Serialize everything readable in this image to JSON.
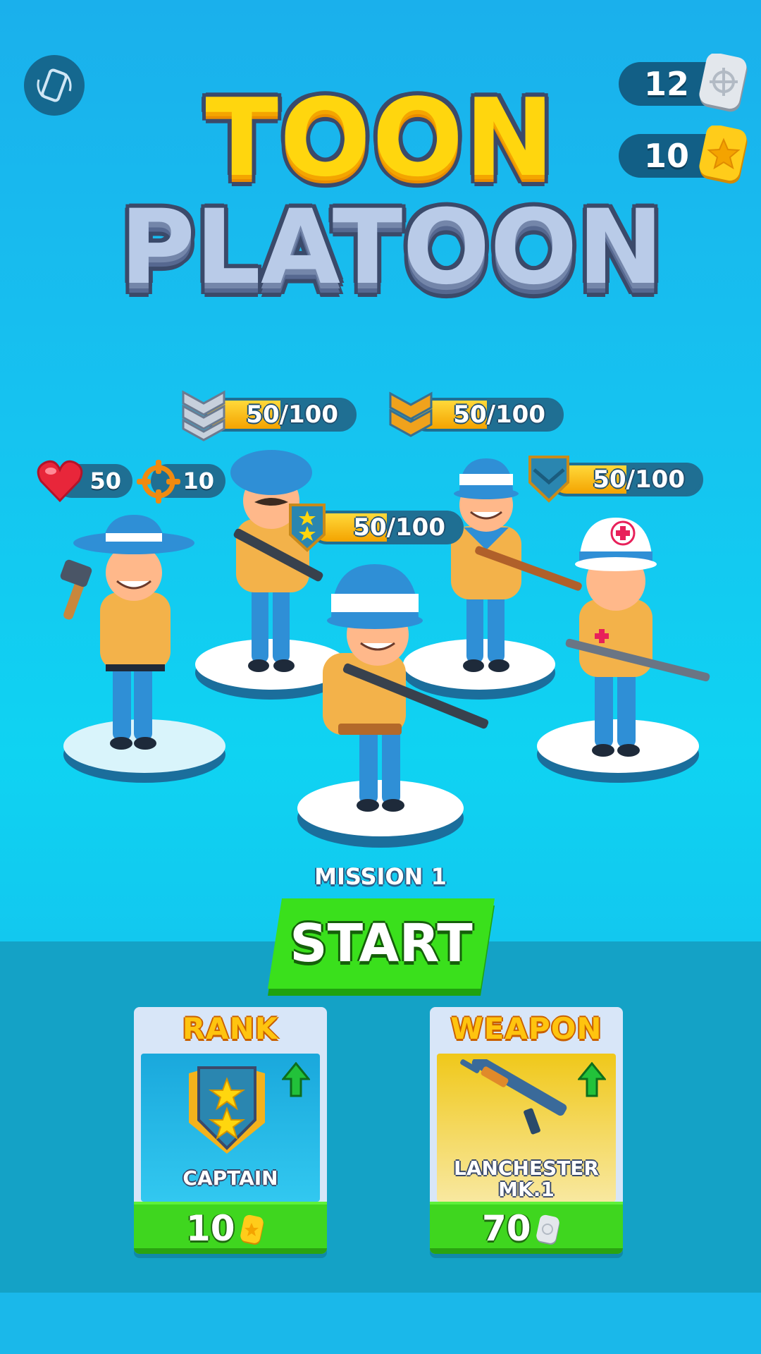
{
  "currency": {
    "silver": {
      "value": "12",
      "icon": "silver-crosshair-coin-icon"
    },
    "gold": {
      "value": "10",
      "icon": "gold-star-coin-icon"
    }
  },
  "title": {
    "line1": "TOON",
    "line2": "PLATOON"
  },
  "hud": {
    "rotate_icon": "rotate-device-icon",
    "health": {
      "icon": "heart-icon",
      "value": "50"
    },
    "damage": {
      "icon": "crosshair-icon",
      "value": "10"
    }
  },
  "soldiers": [
    {
      "id": "heavy",
      "xp_text": "50/100",
      "xp_fraction": 0.5,
      "rank_badge": "chevrons-3-icon"
    },
    {
      "id": "sniper",
      "xp_text": "50/100",
      "xp_fraction": 0.5,
      "rank_badge": "chevrons-2-icon"
    },
    {
      "id": "medic",
      "xp_text": "50/100",
      "xp_fraction": 0.5,
      "rank_badge": "chevron-1-icon"
    },
    {
      "id": "captain",
      "xp_text": "50/100",
      "xp_fraction": 0.5,
      "rank_badge": "captain-stars-icon"
    }
  ],
  "mission": {
    "label": "MISSION 1"
  },
  "start_button": {
    "label": "START"
  },
  "cards": {
    "rank": {
      "title": "RANK",
      "name": "CAPTAIN",
      "cost": "10",
      "cost_icon": "gold-star-coin-icon",
      "upgrade_icon": "green-up-arrow-icon"
    },
    "weapon": {
      "title": "WEAPON",
      "name_line1": "LANCHESTER",
      "name_line2": "MK.1",
      "cost": "70",
      "cost_icon": "silver-crosshair-coin-icon",
      "upgrade_icon": "green-up-arrow-icon"
    }
  },
  "colors": {
    "background": "#16c3f0",
    "bottom_panel": "#14a2c6",
    "gold": "#ffd60e",
    "green": "#3ae01c",
    "pill": "#1f6f93"
  }
}
